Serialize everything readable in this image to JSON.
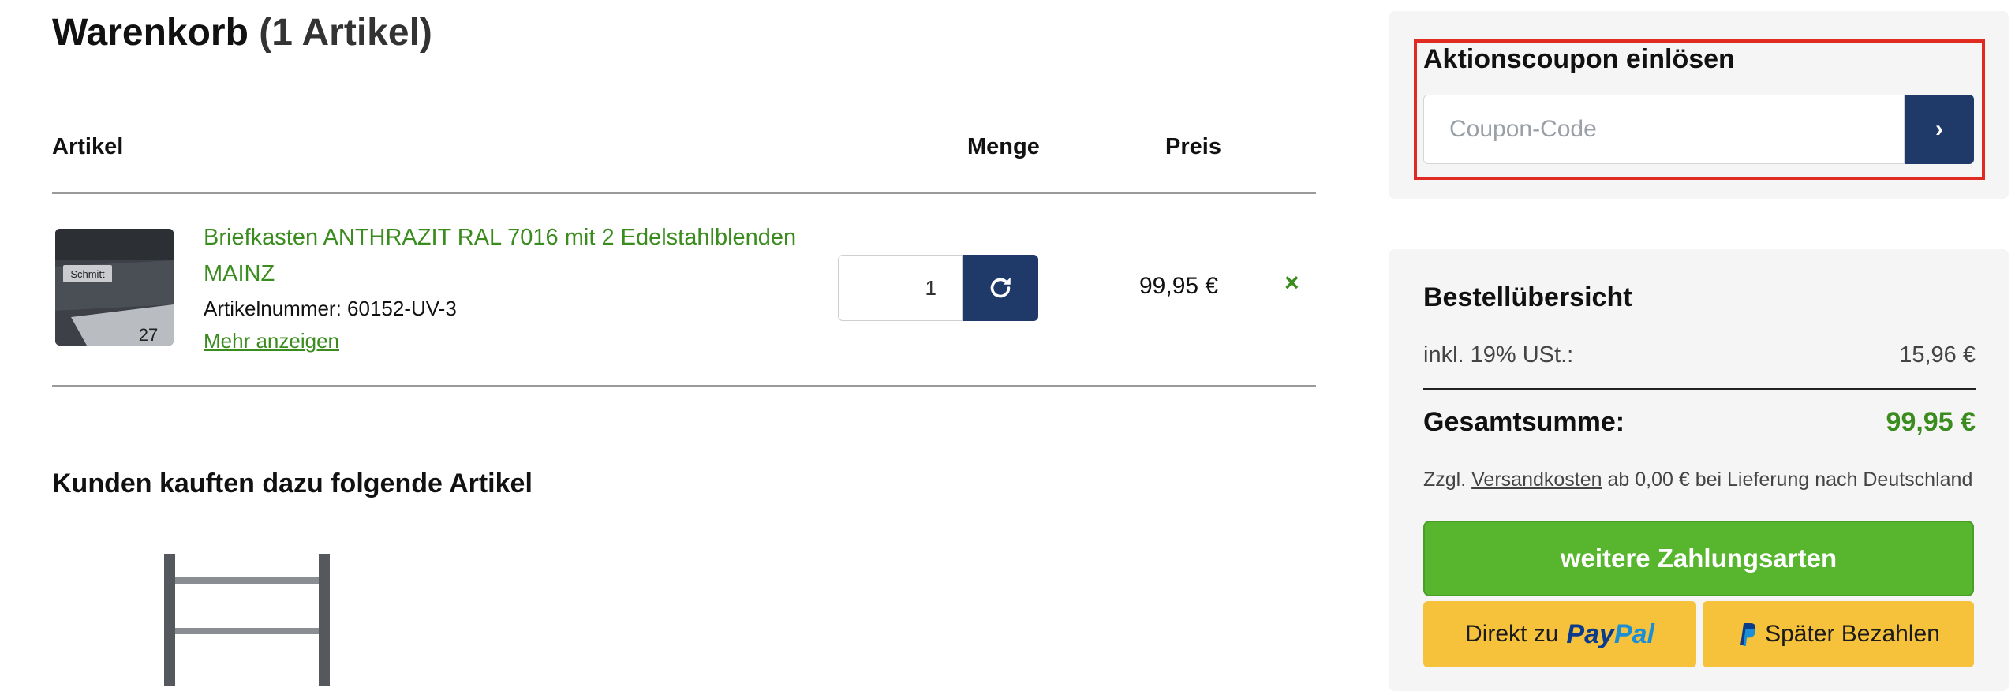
{
  "cart": {
    "title": "Warenkorb",
    "count_label": "(1 Artikel)",
    "columns": {
      "article": "Artikel",
      "quantity": "Menge",
      "price": "Preis"
    }
  },
  "item": {
    "title": "Briefkasten ANTHRAZIT RAL 7016 mit 2 Edelstahlblenden MAINZ",
    "article_number": "Artikelnummer: 60152-UV-3",
    "more_link": "Mehr anzeigen",
    "quantity": "1",
    "price": "99,95 €",
    "remove_symbol": "×",
    "image_labels": {
      "name": "Schmitt",
      "number": "27"
    },
    "refresh_icon": "refresh-icon"
  },
  "upsell": {
    "title": "Kunden kauften dazu folgende Artikel"
  },
  "coupon": {
    "title": "Aktionscoupon einlösen",
    "placeholder": "Coupon-Code",
    "submit_symbol": "›",
    "highlight_color": "#e02b22"
  },
  "summary": {
    "title": "Bestellübersicht",
    "vat_label": "inkl. 19% USt.:",
    "vat_value": "15,96 €",
    "total_label": "Gesamtsumme:",
    "total_value": "99,95 €",
    "shipping_prefix": "Zzgl.",
    "shipping_link": "Versandkosten",
    "shipping_suffix": "ab 0,00 € bei Lieferung nach Deutschland",
    "pay_button": "weitere Zahlungsarten",
    "paypal_prefix": "Direkt zu",
    "paypal_logo_pay": "Pay",
    "paypal_logo_pal": "Pal",
    "paypal_later": "Später Bezahlen"
  },
  "colors": {
    "accent_green": "#3b8c1f",
    "button_green": "#57b62e",
    "navy": "#1f3a68",
    "paypal_yellow": "#f7c23b"
  }
}
